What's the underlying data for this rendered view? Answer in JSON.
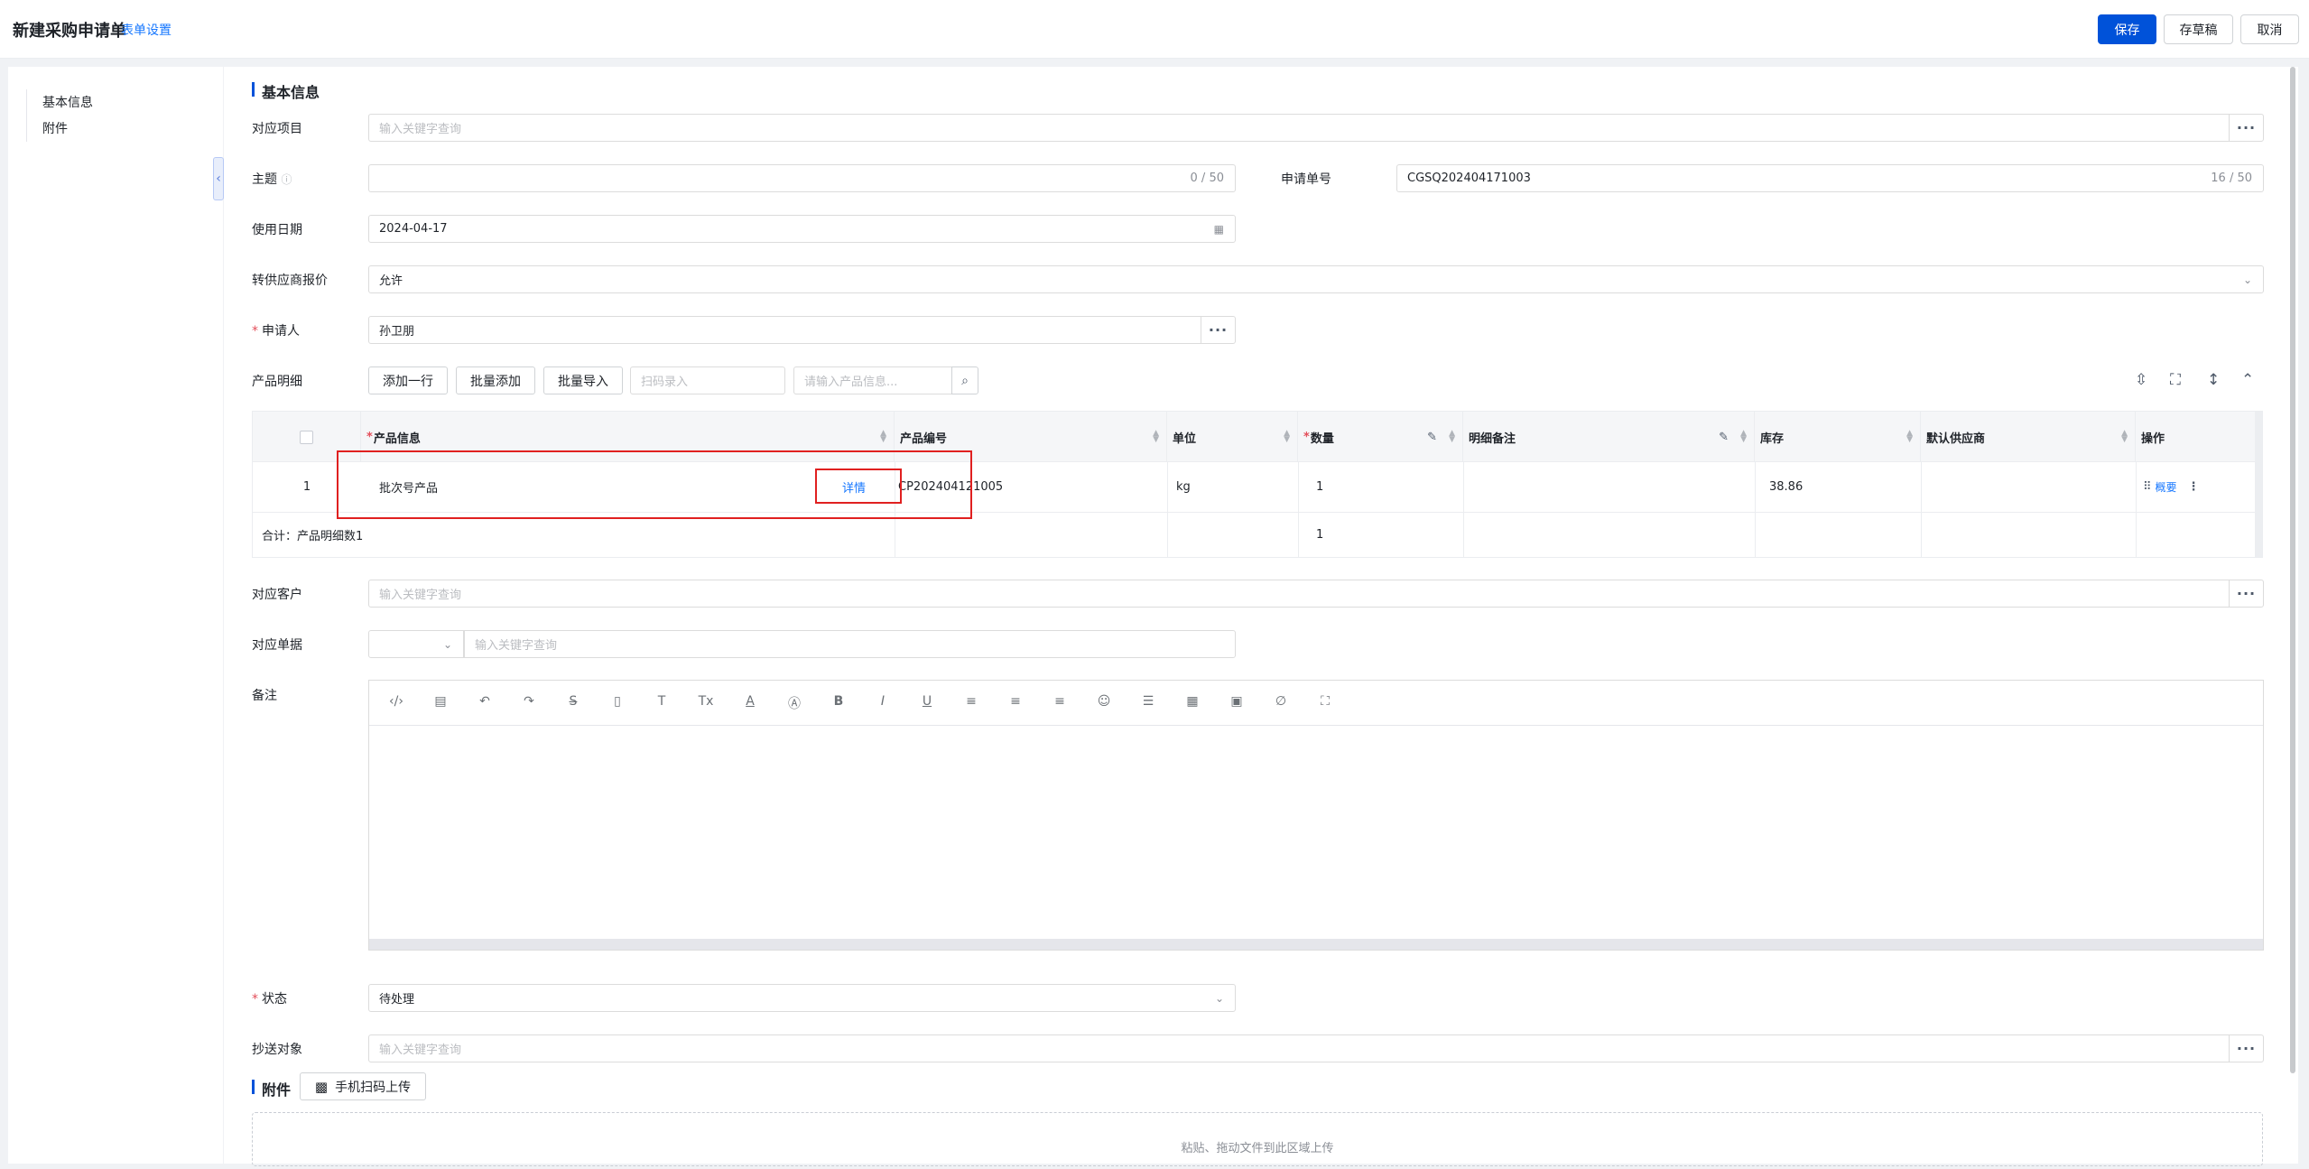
{
  "header": {
    "title": "新建采购申请单",
    "form_settings": "表单设置",
    "save": "保存",
    "draft": "存草稿",
    "cancel": "取消"
  },
  "sidebar": {
    "items": [
      {
        "label": "基本信息"
      },
      {
        "label": "附件"
      }
    ]
  },
  "basic": {
    "section_title": "基本信息",
    "project": {
      "label": "对应项目",
      "placeholder": "输入关键字查询"
    },
    "subject": {
      "label": "主题",
      "counter": "0 / 50"
    },
    "request_no": {
      "label": "申请单号",
      "value": "CGSQ202404171003",
      "counter": "16 / 50"
    },
    "use_date": {
      "label": "使用日期",
      "value": "2024-04-17"
    },
    "supplier_quote": {
      "label": "转供应商报价",
      "value": "允许"
    },
    "applicant": {
      "label": "申请人",
      "value": "孙卫朋"
    },
    "products": {
      "label": "产品明细",
      "add_row": "添加一行",
      "batch_add": "批量添加",
      "batch_import": "批量导入",
      "scan_placeholder": "扫码录入",
      "search_placeholder": "请输入产品信息..."
    },
    "table": {
      "headers": {
        "product_info": "产品信息",
        "product_code": "产品编号",
        "unit": "单位",
        "qty": "数量",
        "detail_note": "明细备注",
        "stock": "库存",
        "default_supplier": "默认供应商",
        "ops": "操作"
      },
      "rows": [
        {
          "index": "1",
          "product_name": "批次号产品",
          "detail_link": "详情",
          "code": "CP202404121005",
          "unit": "kg",
          "qty": "1",
          "stock": "38.86",
          "overview": "概要"
        }
      ],
      "summary": {
        "label": "合计：产品明细数1",
        "qty": "1"
      }
    },
    "customer": {
      "label": "对应客户",
      "placeholder": "输入关键字查询"
    },
    "document": {
      "label": "对应单据",
      "placeholder": "输入关键字查询"
    },
    "remark": {
      "label": "备注"
    },
    "status": {
      "label": "状态",
      "value": "待处理"
    },
    "cc": {
      "label": "抄送对象",
      "placeholder": "输入关键字查询"
    }
  },
  "attachment": {
    "section_title": "附件",
    "scan_upload": "手机扫码上传",
    "drop_hint": "粘贴、拖动文件到此区域上传"
  }
}
